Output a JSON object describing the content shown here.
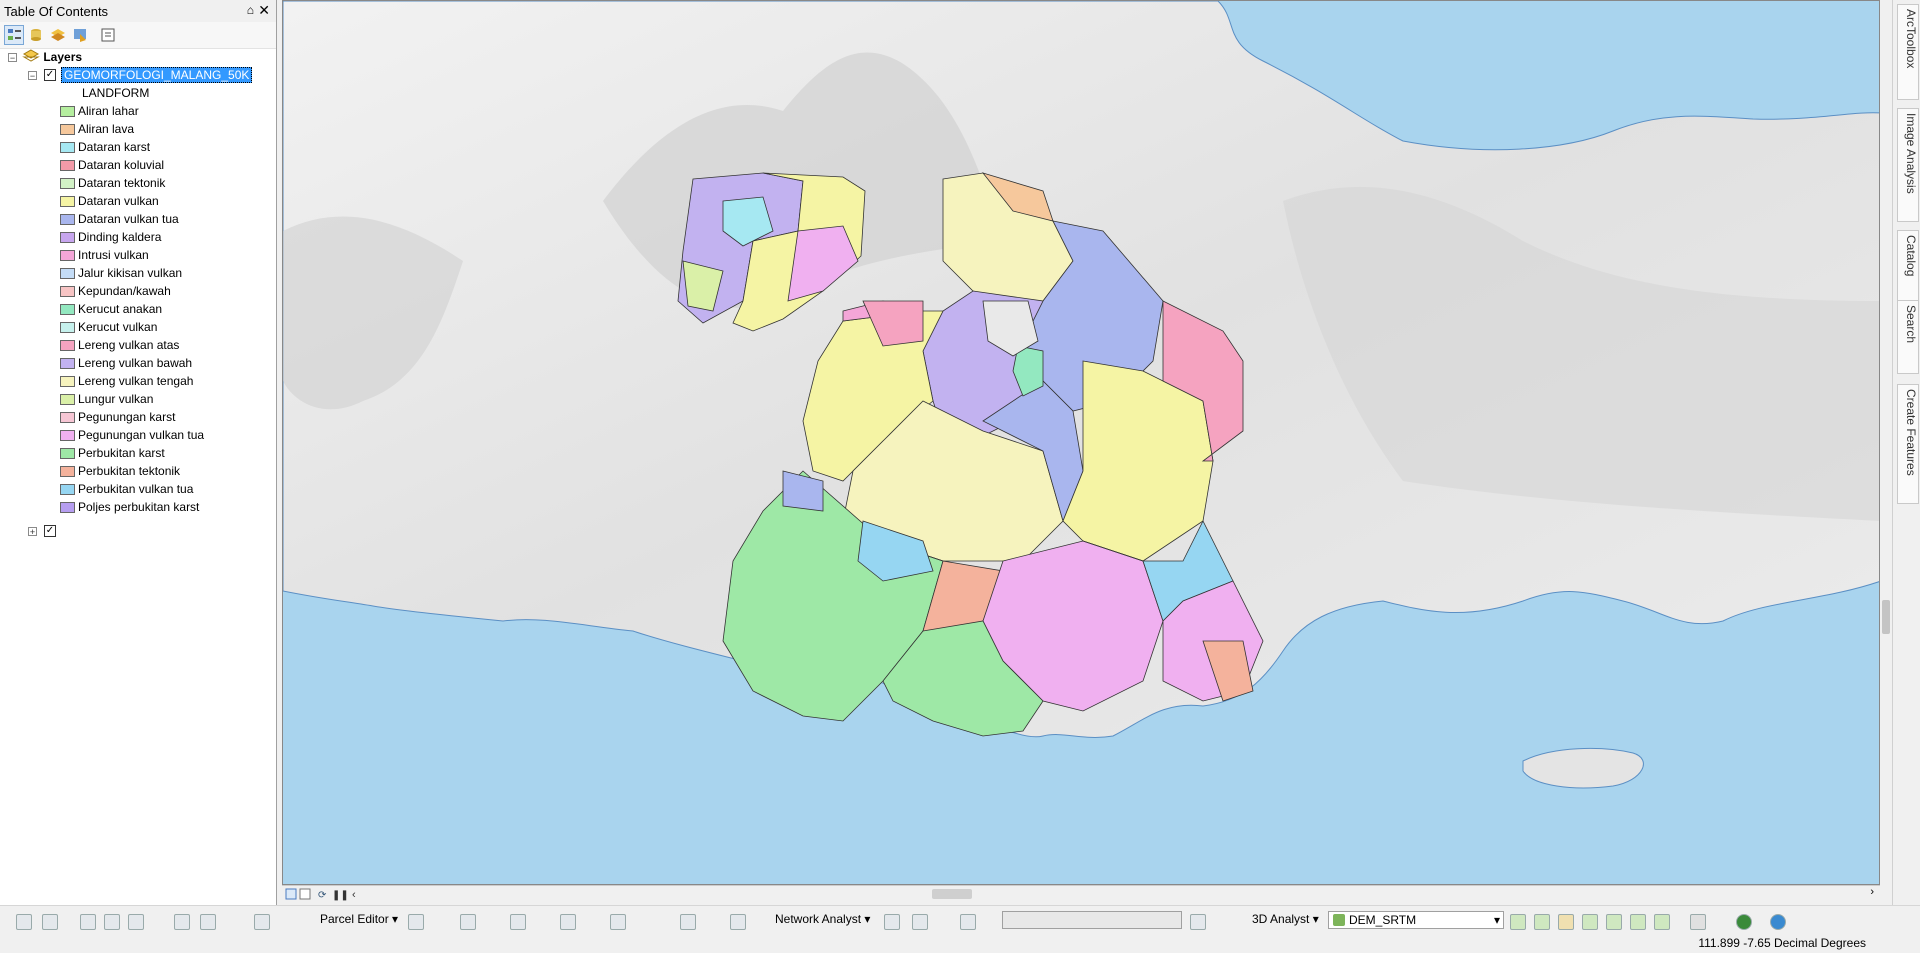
{
  "toc": {
    "title": "Table Of Contents",
    "pin_glyph": "⌂",
    "close_glyph": "✕",
    "root_label": "Layers",
    "layer_name": "GEOMORFOLOGI_MALANG_50K",
    "field_name": "LANDFORM",
    "legend": [
      {
        "label": "Aliran lahar",
        "color": "#b5ee9f"
      },
      {
        "label": "Aliran lava",
        "color": "#f6c89c"
      },
      {
        "label": "Dataran karst",
        "color": "#a6e8f2"
      },
      {
        "label": "Dataran koluvial",
        "color": "#f39aa8"
      },
      {
        "label": "Dataran tektonik",
        "color": "#d2f2c6"
      },
      {
        "label": "Dataran vulkan",
        "color": "#f5f4a4"
      },
      {
        "label": "Dataran vulkan tua",
        "color": "#a9b6ee"
      },
      {
        "label": "Dinding kaldera",
        "color": "#c7a6ee"
      },
      {
        "label": "Intrusi vulkan",
        "color": "#f4a6d8"
      },
      {
        "label": "Jalur kikisan vulkan",
        "color": "#c4dcf6"
      },
      {
        "label": "Kepundan/kawah",
        "color": "#f7c4c4"
      },
      {
        "label": "Kerucut anakan",
        "color": "#93e8c0"
      },
      {
        "label": "Kerucut vulkan",
        "color": "#c6f1ed"
      },
      {
        "label": "Lereng vulkan atas",
        "color": "#f5a3c0"
      },
      {
        "label": "Lereng vulkan bawah",
        "color": "#c2b2f0"
      },
      {
        "label": "Lereng vulkan tengah",
        "color": "#f6f3be"
      },
      {
        "label": "Lungur vulkan",
        "color": "#daf0a8"
      },
      {
        "label": "Pegunungan karst",
        "color": "#f6c6d4"
      },
      {
        "label": "Pegunungan vulkan tua",
        "color": "#f0b0f0"
      },
      {
        "label": "Perbukitan karst",
        "color": "#9ee8a6"
      },
      {
        "label": "Perbukitan tektonik",
        "color": "#f4b29c"
      },
      {
        "label": "Perbukitan vulkan tua",
        "color": "#96d6f2"
      },
      {
        "label": "Poljes perbukitan karst",
        "color": "#b69ef0"
      }
    ]
  },
  "sidebar": {
    "tabs": [
      "ArcToolbox",
      "Image Analysis",
      "Catalog",
      "Search",
      "Create Features"
    ]
  },
  "toolbar": {
    "parcel_editor": "Parcel Editor",
    "network_analyst": "Network Analyst",
    "analyst_3d": "3D Analyst",
    "surface_layer": "DEM_SRTM",
    "dropdown_glyph": "▾"
  },
  "status": {
    "coordinates": "111.899  -7.65 Decimal Degrees"
  },
  "colors": {
    "sea": "#a9d4ee",
    "land": "#e9e9e9",
    "selection": "#3399ff"
  }
}
